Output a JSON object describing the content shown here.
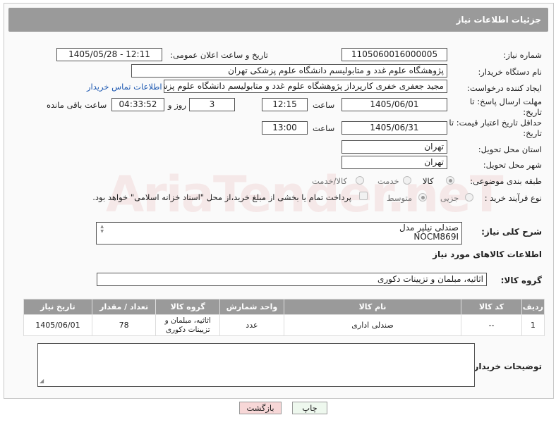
{
  "header": {
    "title": "جزئیات اطلاعات نیاز"
  },
  "form": {
    "need_number_label": "شماره نیاز:",
    "need_number": "1105060016000005",
    "announce_label": "تاریخ و ساعت اعلان عمومی:",
    "announce_value": "1405/05/28 - 12:11",
    "buyer_org_label": "نام دستگاه خریدار:",
    "buyer_org": "پژوهشگاه علوم غدد و متابولیسم دانشگاه علوم پزشکی تهران",
    "creator_label": "ایجاد کننده درخواست:",
    "creator": "مجید  جعفری خفری کارپرداز پژوهشگاه علوم غدد و متابولیسم دانشگاه علوم پزشکی",
    "buyer_contact_link": "اطلاعات تماس خریدار",
    "deadline_label": "مهلت ارسال پاسخ: تا تاریخ:",
    "deadline_date": "1405/06/01",
    "time_label": "ساعت",
    "deadline_time": "12:15",
    "days": "3",
    "days_label": "روز و",
    "remaining": "04:33:52",
    "remaining_label": "ساعت باقی مانده",
    "price_deadline_label": "حداقل تاریخ اعتبار قیمت: تا تاریخ:",
    "price_deadline_date": "1405/06/31",
    "price_deadline_time": "13:00",
    "province_label": "استان محل تحویل:",
    "province": "تهران",
    "city_label": "شهر محل تحویل:",
    "city": "تهران",
    "category_label": "طبقه بندی موضوعی:",
    "category_options": [
      "کالا",
      "خدمت",
      "کالا/خدمت"
    ],
    "category_selected": "کالا",
    "process_label": "نوع فرآیند خرید :",
    "process_options": [
      "جزیی",
      "متوسط"
    ],
    "process_selected": "متوسط",
    "payment_note": "پرداخت تمام یا بخشی از مبلغ خرید،از محل \"اسناد خزانه اسلامی\" خواهد بود.",
    "description_label": "شرح کلی نیاز:",
    "description_line1": "صندلی نیلپر مدل",
    "description_line2": "NOCM869I",
    "goods_info_title": "اطلاعات کالاهای مورد نیاز",
    "goods_group_label": "گروه کالا:",
    "goods_group": "اثاثیه، مبلمان و تزیینات دکوری",
    "buyer_notes_label": "توضیحات خریدار:"
  },
  "table": {
    "headers": [
      "ردیف",
      "کد کالا",
      "نام کالا",
      "واحد شمارش",
      "گروه کالا",
      "تعداد / مقدار",
      "تاریخ نیاز"
    ],
    "rows": [
      [
        "1",
        "--",
        "صندلی اداری",
        "عدد",
        "اثاثیه، مبلمان و تزیینات دکوری",
        "78",
        "1405/06/01"
      ]
    ]
  },
  "buttons": {
    "print": "چاپ",
    "back": "بازگشت"
  },
  "watermark": "AriaTender.neT",
  "colors": {
    "header_bg": "#9a9a9a",
    "link": "#1a56b0",
    "back_btn": "#f7d7d7"
  }
}
